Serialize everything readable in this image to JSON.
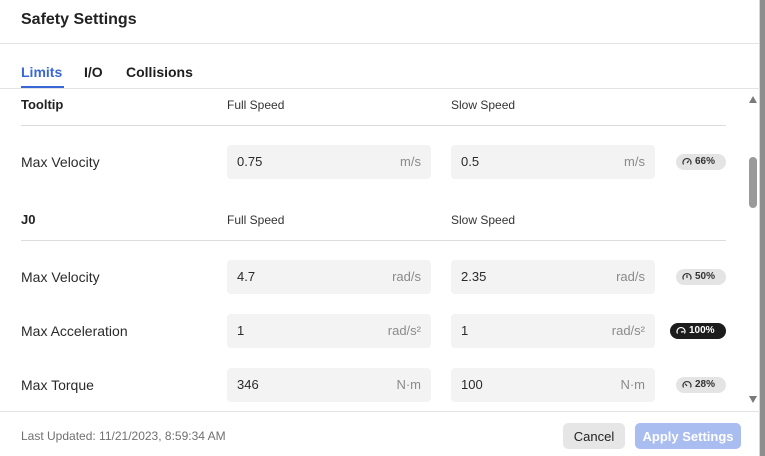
{
  "dialog": {
    "title": "Safety Settings"
  },
  "tabs": [
    {
      "label": "Limits",
      "active": true
    },
    {
      "label": "I/O",
      "active": false
    },
    {
      "label": "Collisions",
      "active": false
    }
  ],
  "sections": [
    {
      "title": "Tooltip",
      "col_full": "Full Speed",
      "col_slow": "Slow Speed",
      "rows": [
        {
          "label": "Max Velocity",
          "full_value": "0.75",
          "full_unit": "m/s",
          "slow_value": "0.5",
          "slow_unit": "m/s",
          "badge": "66%",
          "badge_style": "normal"
        }
      ]
    },
    {
      "title": "J0",
      "col_full": "Full Speed",
      "col_slow": "Slow Speed",
      "rows": [
        {
          "label": "Max Velocity",
          "full_value": "4.7",
          "full_unit": "rad/s",
          "slow_value": "2.35",
          "slow_unit": "rad/s",
          "badge": "50%",
          "badge_style": "normal"
        },
        {
          "label": "Max Acceleration",
          "full_value": "1",
          "full_unit": "rad/s²",
          "slow_value": "1",
          "slow_unit": "rad/s²",
          "badge": "100%",
          "badge_style": "full"
        },
        {
          "label": "Max Torque",
          "full_value": "346",
          "full_unit": "N·m",
          "slow_value": "100",
          "slow_unit": "N·m",
          "badge": "28%",
          "badge_style": "normal"
        }
      ]
    }
  ],
  "footer": {
    "last_updated": "Last Updated: 11/21/2023, 8:59:34 AM",
    "cancel_label": "Cancel",
    "apply_label": "Apply Settings"
  },
  "colors": {
    "accent": "#3a67d8",
    "apply_disabled": "#a9bdf0",
    "badge_full": "#1c1c1c"
  },
  "icons": {
    "badge_icon": "gauge-icon"
  }
}
